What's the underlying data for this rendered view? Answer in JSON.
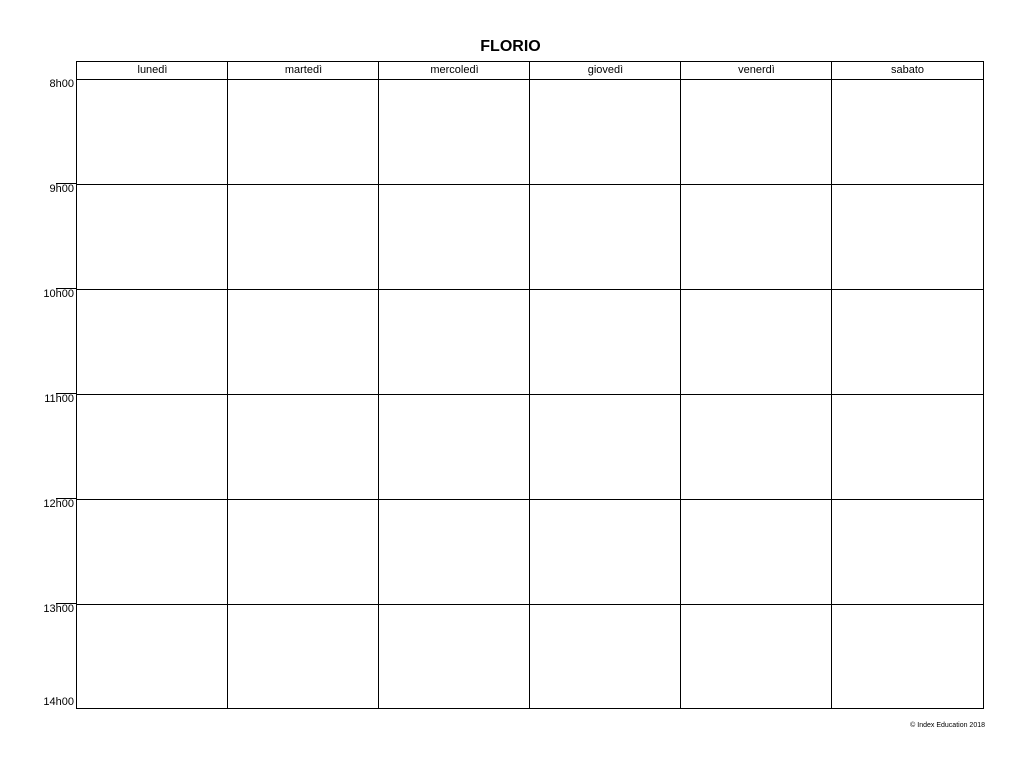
{
  "title": "FLORIO",
  "days": [
    "lunedì",
    "martedì",
    "mercoledì",
    "giovedì",
    "venerdì",
    "sabato"
  ],
  "hours": [
    "8h00",
    "9h00",
    "10h00",
    "11h00",
    "12h00",
    "13h00",
    "14h00"
  ],
  "copyright": "© Index Education 2018"
}
